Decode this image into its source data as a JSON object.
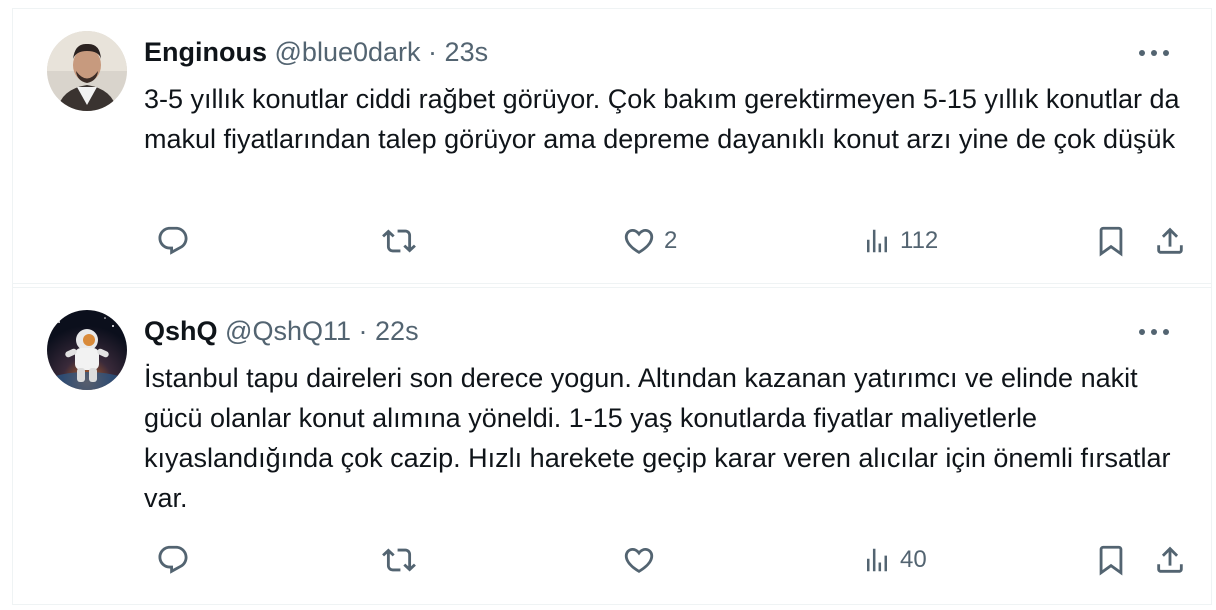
{
  "tweets": [
    {
      "name": "Enginous",
      "handle": "@blue0dark",
      "separator": "·",
      "time": "23s",
      "text": "3-5 yıllık konutlar ciddi rağbet görüyor. Çok bakım gerektirmeyen 5-15 yıllık konutlar da makul fiyatlarından talep görüyor ama depreme dayanıklı konut arzı yine de çok düşük",
      "replies": "",
      "retweets": "",
      "likes": "2",
      "views": "112"
    },
    {
      "name": "QshQ",
      "handle": "@QshQ11",
      "separator": "·",
      "time": "22s",
      "text": "İstanbul tapu daireleri son derece yogun. Altından kazanan yatırımcı ve elinde nakit gücü olanlar konut alımına yöneldi. 1-15 yaş konutlarda fiyatlar maliyetlerle kıyaslandığında çok cazip. Hızlı harekete geçip karar veren alıcılar için önemli fırsatlar var.",
      "replies": "",
      "retweets": "",
      "likes": "",
      "views": "40"
    }
  ],
  "icons": {
    "reply": "reply-icon",
    "retweet": "retweet-icon",
    "like": "heart-icon",
    "views": "views-icon",
    "bookmark": "bookmark-icon",
    "share": "share-icon",
    "more": "more-icon"
  },
  "colors": {
    "text": "#0f1419",
    "secondary": "#536471",
    "border": "#eff3f4"
  }
}
